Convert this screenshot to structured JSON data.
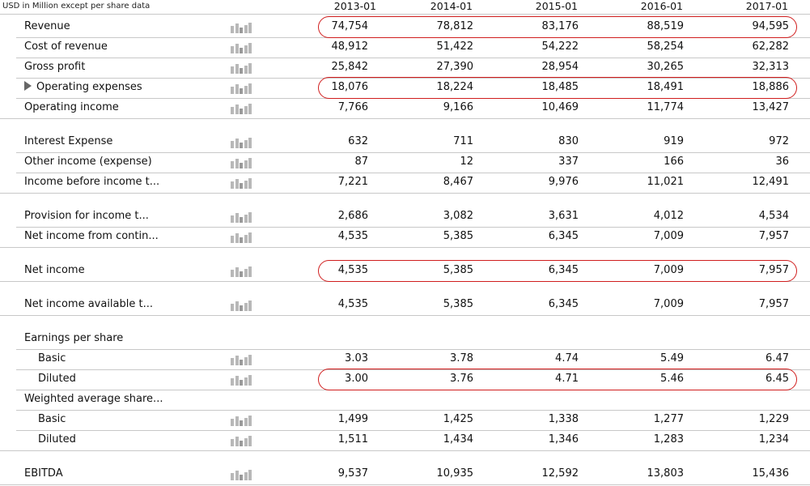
{
  "caption": "USD in Million except per share data",
  "years": [
    "2013-01",
    "2014-01",
    "2015-01",
    "2016-01",
    "2017-01"
  ],
  "rows": [
    {
      "label": "Revenue",
      "values": [
        "74,754",
        "78,812",
        "83,176",
        "88,519",
        "94,595"
      ]
    },
    {
      "label": "Cost of revenue",
      "values": [
        "48,912",
        "51,422",
        "54,222",
        "58,254",
        "62,282"
      ]
    },
    {
      "label": "Gross profit",
      "values": [
        "25,842",
        "27,390",
        "28,954",
        "30,265",
        "32,313"
      ]
    },
    {
      "label": "Operating expenses",
      "values": [
        "18,076",
        "18,224",
        "18,485",
        "18,491",
        "18,886"
      ]
    },
    {
      "label": "Operating income",
      "values": [
        "7,766",
        "9,166",
        "10,469",
        "11,774",
        "13,427"
      ]
    },
    {
      "label": "Interest Expense",
      "values": [
        "632",
        "711",
        "830",
        "919",
        "972"
      ]
    },
    {
      "label": "Other income (expense)",
      "values": [
        "87",
        "12",
        "337",
        "166",
        "36"
      ]
    },
    {
      "label": "Income before income t...",
      "values": [
        "7,221",
        "8,467",
        "9,976",
        "11,021",
        "12,491"
      ]
    },
    {
      "label": "Provision for income t...",
      "values": [
        "2,686",
        "3,082",
        "3,631",
        "4,012",
        "4,534"
      ]
    },
    {
      "label": "Net income from contin...",
      "values": [
        "4,535",
        "5,385",
        "6,345",
        "7,009",
        "7,957"
      ]
    },
    {
      "label": "Net income",
      "values": [
        "4,535",
        "5,385",
        "6,345",
        "7,009",
        "7,957"
      ]
    },
    {
      "label": "Net income available t...",
      "values": [
        "4,535",
        "5,385",
        "6,345",
        "7,009",
        "7,957"
      ]
    },
    {
      "label": "Earnings per share",
      "values": [
        "",
        "",
        "",
        "",
        ""
      ]
    },
    {
      "label": "Basic",
      "values": [
        "3.03",
        "3.78",
        "4.74",
        "5.49",
        "6.47"
      ]
    },
    {
      "label": "Diluted",
      "values": [
        "3.00",
        "3.76",
        "4.71",
        "5.46",
        "6.45"
      ]
    },
    {
      "label": "Weighted average share...",
      "values": [
        "",
        "",
        "",
        "",
        ""
      ]
    },
    {
      "label": "Basic",
      "values": [
        "1,499",
        "1,425",
        "1,338",
        "1,277",
        "1,229"
      ]
    },
    {
      "label": "Diluted",
      "values": [
        "1,511",
        "1,434",
        "1,346",
        "1,283",
        "1,234"
      ]
    },
    {
      "label": "EBITDA",
      "values": [
        "9,537",
        "10,935",
        "12,592",
        "13,803",
        "15,436"
      ]
    }
  ],
  "highlight_color": "#d01d1d",
  "chart_icon": "bar-chart-icon",
  "expand_icon": "triangle-right-icon"
}
